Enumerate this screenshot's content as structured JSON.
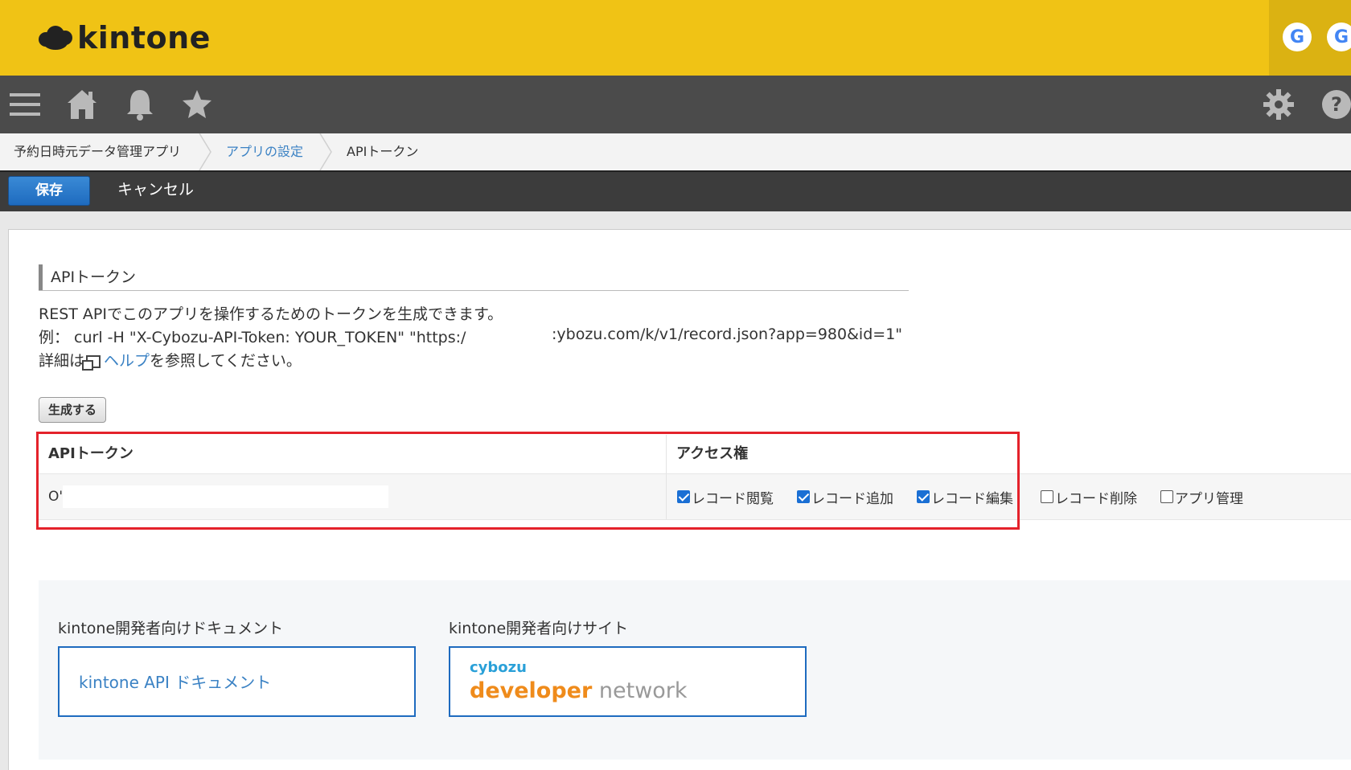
{
  "header": {
    "logo_text": "kintone",
    "avatars": [
      "G",
      "G"
    ],
    "brand_color": "#f0c315"
  },
  "nav": {
    "icons": [
      "menu-icon",
      "home-icon",
      "bell-icon",
      "star-icon",
      "gear-icon",
      "help-icon"
    ]
  },
  "breadcrumb": {
    "items": [
      "予約日時元データ管理アプリ",
      "アプリの設定",
      "APIトークン"
    ]
  },
  "actions": {
    "save_label": "保存",
    "cancel_label": "キャンセル"
  },
  "section": {
    "title": "APIトークン",
    "desc_line1": "REST APIでこのアプリを操作するためのトークンを生成できます。",
    "desc_line2a": "例： curl -H \"X-Cybozu-API-Token: YOUR_TOKEN\" \"https:/",
    "desc_line2b": ":ybozu.com/k/v1/record.json?app=980&id=1\"",
    "desc_line3_prefix": "詳細は",
    "help_link": "ヘルプ",
    "desc_line3_suffix": "を参照してください。",
    "generate_label": "生成する"
  },
  "table": {
    "headers": [
      "APIトークン",
      "アクセス権"
    ],
    "token_value": "O'",
    "permissions": [
      {
        "label": "レコード閲覧",
        "checked": true
      },
      {
        "label": "レコード追加",
        "checked": true
      },
      {
        "label": "レコード編集",
        "checked": true
      },
      {
        "label": "レコード削除",
        "checked": false
      },
      {
        "label": "アプリ管理",
        "checked": false
      }
    ]
  },
  "developer": {
    "docs_heading": "kintone開発者向けドキュメント",
    "docs_link": "kintone API ドキュメント",
    "site_heading": "kintone開発者向けサイト",
    "site_logo_top": "cybozu",
    "site_logo_main": "developer",
    "site_logo_sub": " network"
  }
}
